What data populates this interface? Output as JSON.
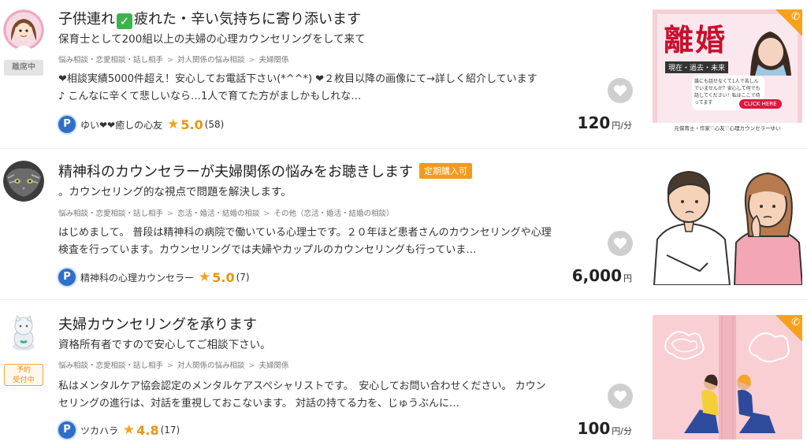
{
  "listings": [
    {
      "status": "離席中",
      "title_part1": "子供連れ",
      "title_check": "✓",
      "title_part2": "疲れた・辛い気持ちに寄り添います",
      "subtitle": "保育士として200組以上の夫婦の心理カウンセリングをして来て",
      "breadcrumbs": [
        "悩み相談・恋愛相談・話し相手",
        "対人関係の悩み相談",
        "夫婦関係"
      ],
      "desc_lines": [
        "❤相談実績5000件超え！安心してお電話下さい(*^^*) ❤２枚目以降の画像にて→詳しく紹介しています",
        "♪ こんなに辛くて悲しいなら…1人で育てた方がましかもしれな…"
      ],
      "author": "ゆい❤❤癒しの心友",
      "rating": "5.0",
      "review_count": "(58)",
      "price": "120",
      "price_unit": "円/分",
      "thumb_text": {
        "big": "離婚",
        "tagline": "現在・過去・未来",
        "bubble": "誰にも話せなくて1人で苦しんでいませんか？安心して何でも話してください！私はここで待ってます",
        "click": "CLICK HERE",
        "footer": "元保育士・作家♡心友♡心理カウンセラーゆい"
      }
    },
    {
      "title": "精神科のカウンセラーが夫婦関係の悩みをお聴きします",
      "badge": "定期購入可",
      "subtitle": "。カウンセリング的な視点で問題を解決します。",
      "breadcrumbs": [
        "悩み相談・恋愛相談・話し相手",
        "恋活・婚活・結婚の相談",
        "その他（恋活・婚活・結婚の相談）"
      ],
      "desc_lines": [
        "はじめまして。 普段は精神科の病院で働いている心理士です。２０年ほど患者さんのカウンセリングや心理",
        "検査を行っています。カウンセリングでは夫婦やカップルのカウンセリングも行っていま…"
      ],
      "author": "精神科の心理カウンセラー",
      "rating": "5.0",
      "review_count": "(7)",
      "price": "6,000",
      "price_unit": "円"
    },
    {
      "status": "予約受付中",
      "status_line1": "予約",
      "status_line2": "受付中",
      "title": "夫婦カウンセリングを承ります",
      "subtitle": "資格所有者ですので安心してご相談下さい。",
      "breadcrumbs": [
        "悩み相談・恋愛相談・話し相手",
        "対人関係の悩み相談",
        "夫婦関係"
      ],
      "desc_lines": [
        "私はメンタルケア協会認定のメンタルケアスペシャリストです。　安心してお問い合わせください。 カウン",
        "セリングの進行は、対話を重視しておこないます。 対話の持てる力を、じゅうぶんに…"
      ],
      "author": "ツカハラ",
      "rating": "4.8",
      "review_count": "(17)",
      "price": "100",
      "price_unit": "円/分"
    }
  ],
  "icons": {
    "p_badge": "P",
    "star": "★",
    "phone": "✆",
    "heart": "❤"
  },
  "colors": {
    "accent_orange": "#f39a1c",
    "rating_orange": "#e99414",
    "p_blue": "#2f6fc7",
    "heart_red": "#d9261c",
    "fav_gray": "#cfcfcf",
    "check_green": "#3cb44b"
  }
}
